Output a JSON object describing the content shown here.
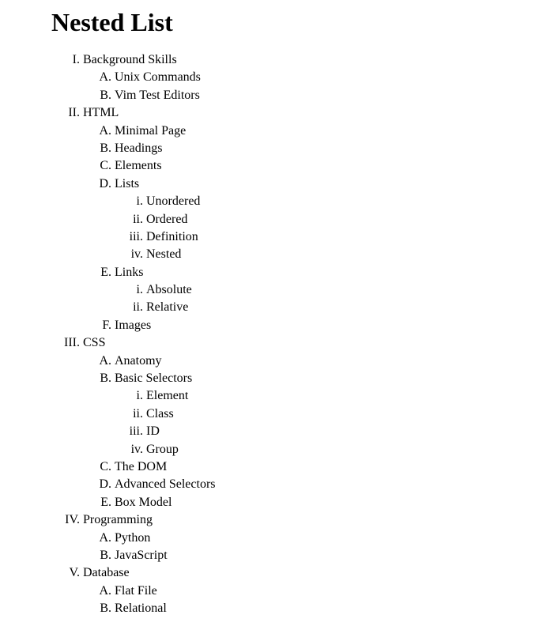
{
  "title": "Nested List",
  "outline": [
    {
      "label": "Background Skills",
      "children": [
        {
          "label": "Unix Commands"
        },
        {
          "label": "Vim Test Editors"
        }
      ]
    },
    {
      "label": "HTML",
      "children": [
        {
          "label": "Minimal Page"
        },
        {
          "label": "Headings"
        },
        {
          "label": "Elements"
        },
        {
          "label": "Lists",
          "children": [
            {
              "label": "Unordered"
            },
            {
              "label": "Ordered"
            },
            {
              "label": "Definition"
            },
            {
              "label": "Nested"
            }
          ]
        },
        {
          "label": "Links",
          "children": [
            {
              "label": "Absolute"
            },
            {
              "label": "Relative"
            }
          ]
        },
        {
          "label": "Images"
        }
      ]
    },
    {
      "label": "CSS",
      "children": [
        {
          "label": "Anatomy"
        },
        {
          "label": "Basic Selectors",
          "children": [
            {
              "label": "Element"
            },
            {
              "label": "Class"
            },
            {
              "label": "ID"
            },
            {
              "label": "Group"
            }
          ]
        },
        {
          "label": "The DOM"
        },
        {
          "label": "Advanced Selectors"
        },
        {
          "label": "Box Model"
        }
      ]
    },
    {
      "label": "Programming",
      "children": [
        {
          "label": "Python"
        },
        {
          "label": "JavaScript"
        }
      ]
    },
    {
      "label": "Database",
      "children": [
        {
          "label": "Flat File"
        },
        {
          "label": "Relational"
        }
      ]
    }
  ]
}
